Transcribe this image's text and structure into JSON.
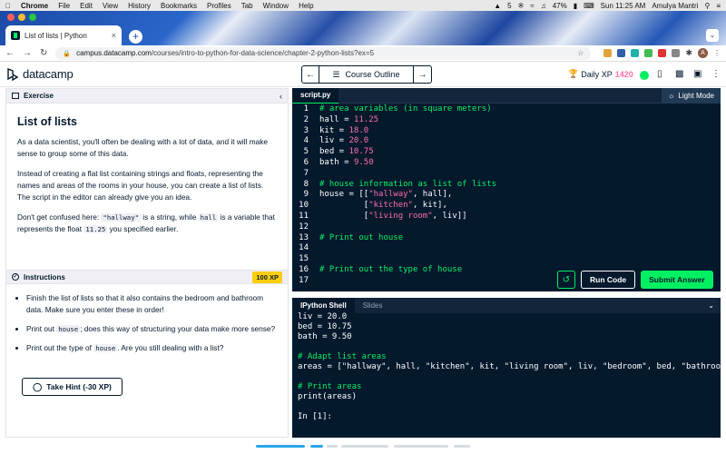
{
  "menubar": {
    "app": "Chrome",
    "items": [
      "File",
      "Edit",
      "View",
      "History",
      "Bookmarks",
      "Profiles",
      "Tab",
      "Window",
      "Help"
    ],
    "status_count": "5",
    "battery": "47%",
    "clock": "Sun 11:25 AM",
    "user": "Amulya Mantri"
  },
  "browser": {
    "tab_title": "List of lists | Python",
    "url_host": "campus.datacamp.com",
    "url_path": "/courses/intro-to-python-for-data-science/chapter-2-python-lists?ex=5",
    "profile_initial": "A"
  },
  "header": {
    "logo": "datacamp",
    "course_outline": "Course Outline",
    "daily_xp_label": "Daily XP",
    "daily_xp_value": "1420"
  },
  "exercise": {
    "section_label": "Exercise",
    "title": "List of lists",
    "p1": "As a data scientist, you'll often be dealing with a lot of data, and it will make sense to group some of this data.",
    "p2": "Instead of creating a flat list containing strings and floats, representing the names and areas of the rooms in your house, you can create a list of lists. The script in the editor can already give you an idea.",
    "p3_a": "Don't get confused here: ",
    "p3_code1": "\"hallway\"",
    "p3_b": " is a string, while ",
    "p3_code2": "hall",
    "p3_c": " is a variable that represents the float ",
    "p3_code3": "11.25",
    "p3_d": " you specified earlier."
  },
  "instructions": {
    "label": "Instructions",
    "xp_badge": "100 XP",
    "i1": "Finish the list of lists so that it also contains the bedroom and bathroom data. Make sure you enter these in order!",
    "i2_a": "Print out ",
    "i2_code": "house",
    "i2_b": "; does this way of structuring your data make more sense?",
    "i3_a": "Print out the type of ",
    "i3_code": "house",
    "i3_b": ". Are you still dealing with a list?",
    "hint_button": "Take Hint (-30 XP)"
  },
  "editor": {
    "file_tab": "script.py",
    "light_mode": "Light Mode",
    "run_code": "Run Code",
    "submit": "Submit Answer",
    "lines": [
      {
        "n": "1",
        "t": "# area variables (in square meters)",
        "k": "cm"
      },
      {
        "n": "2",
        "t": "hall = ",
        "v": "11.25"
      },
      {
        "n": "3",
        "t": "kit = ",
        "v": "18.0"
      },
      {
        "n": "4",
        "t": "liv = ",
        "v": "20.0"
      },
      {
        "n": "5",
        "t": "bed = ",
        "v": "10.75"
      },
      {
        "n": "6",
        "t": "bath = ",
        "v": "9.50"
      },
      {
        "n": "7",
        "t": ""
      },
      {
        "n": "8",
        "t": "# house information as list of lists",
        "k": "cm"
      },
      {
        "n": "9",
        "t": "house = [[",
        "s": "\"hallway\"",
        "e": ", hall],"
      },
      {
        "n": "10",
        "t": "         [",
        "s": "\"kitchen\"",
        "e": ", kit],"
      },
      {
        "n": "11",
        "t": "         [",
        "s": "\"living room\"",
        "e": ", liv]]"
      },
      {
        "n": "12",
        "t": ""
      },
      {
        "n": "13",
        "t": "# Print out house",
        "k": "cm"
      },
      {
        "n": "14",
        "t": ""
      },
      {
        "n": "15",
        "t": ""
      },
      {
        "n": "16",
        "t": "# Print out the type of house",
        "k": "cm"
      },
      {
        "n": "17",
        "t": ""
      }
    ]
  },
  "shell": {
    "tab_ipython": "IPython Shell",
    "tab_slides": "Slides",
    "lines": [
      {
        "t": "liv = 20.0"
      },
      {
        "t": "bed = 10.75"
      },
      {
        "t": "bath = 9.50"
      },
      {
        "t": ""
      },
      {
        "t": "# Adapt list areas",
        "k": "cm"
      },
      {
        "t": "areas = [\"hallway\", hall, \"kitchen\", kit, \"living room\", liv, \"bedroom\", bed, \"bathroom\", bath]"
      },
      {
        "t": ""
      },
      {
        "t": "# Print areas",
        "k": "cm"
      },
      {
        "t": "print(areas)"
      },
      {
        "t": ""
      },
      {
        "t": "In [1]:"
      }
    ]
  },
  "colors": {
    "brand_green": "#03ef62",
    "navy": "#05192d",
    "xp_pink": "#ff6ea9",
    "badge_yellow": "#fcce0d"
  }
}
